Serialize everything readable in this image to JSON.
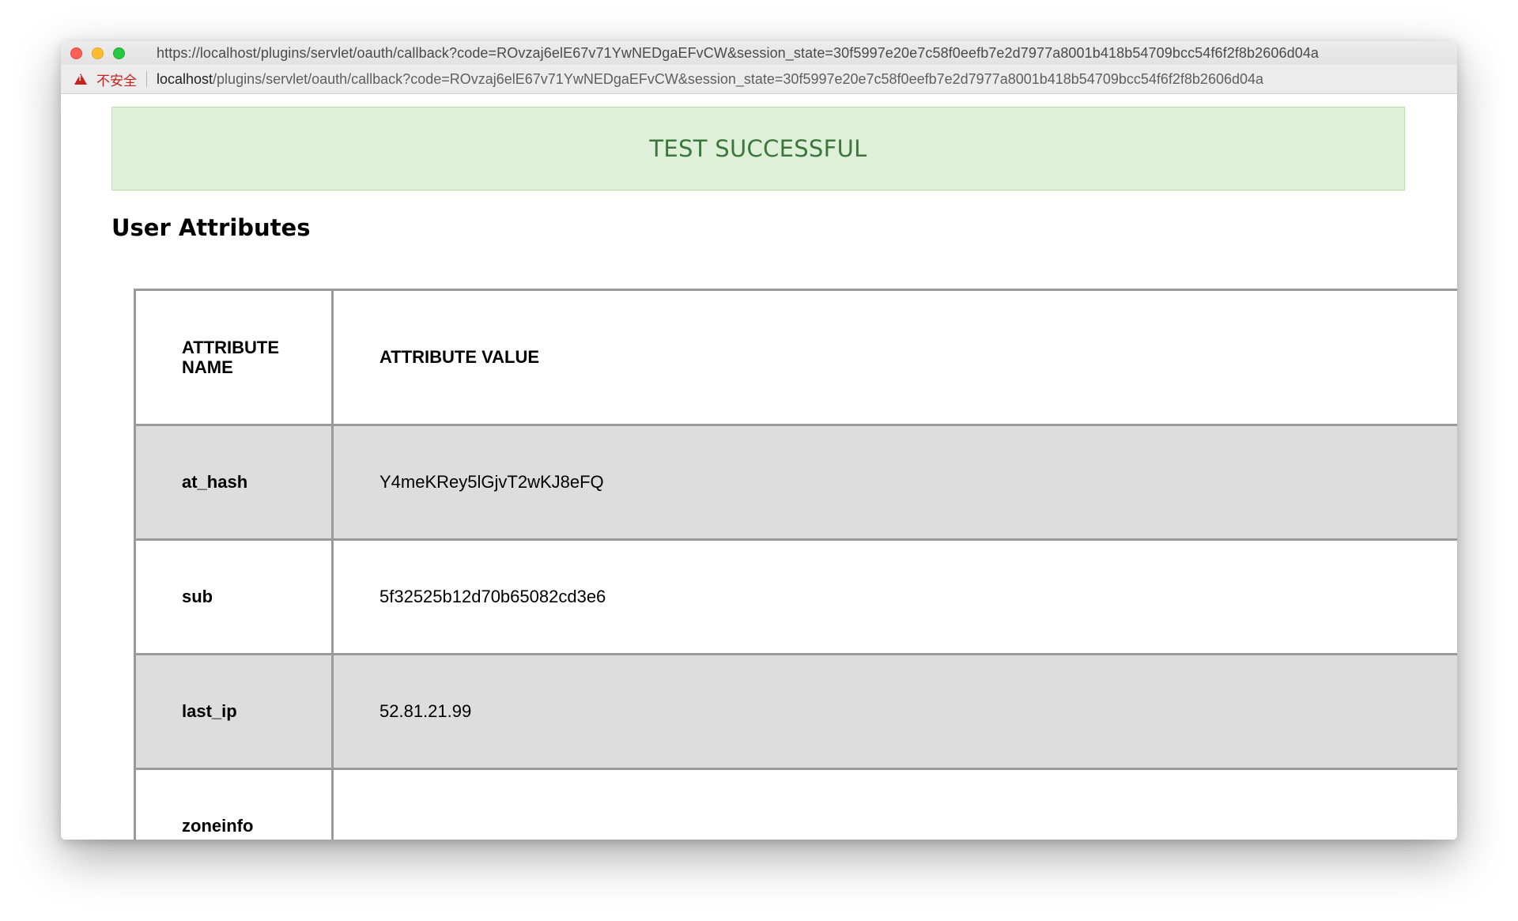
{
  "window": {
    "title": "https://localhost/plugins/servlet/oauth/callback?code=ROvzaj6elE67v71YwNEDgaEFvCW&session_state=30f5997e20e7c58f0eefb7e2d7977a8001b418b54709bcc54f6f2f8b2606d04a"
  },
  "address_bar": {
    "security_label": "不安全",
    "host": "localhost",
    "path": "/plugins/servlet/oauth/callback?code=ROvzaj6elE67v71YwNEDgaEFvCW&session_state=30f5997e20e7c58f0eefb7e2d7977a8001b418b54709bcc54f6f2f8b2606d04a"
  },
  "banner": {
    "text": "TEST SUCCESSFUL",
    "background_color": "#dff0d8",
    "text_color": "#3c763d"
  },
  "section": {
    "title": "User Attributes"
  },
  "table": {
    "header_name": "ATTRIBUTE NAME",
    "header_value": "ATTRIBUTE VALUE",
    "rows": [
      {
        "name": "at_hash",
        "value": "Y4meKRey5lGjvT2wKJ8eFQ"
      },
      {
        "name": "sub",
        "value": "5f32525b12d70b65082cd3e6"
      },
      {
        "name": "last_ip",
        "value": "52.81.21.99"
      },
      {
        "name": "zoneinfo",
        "value": ""
      }
    ]
  }
}
